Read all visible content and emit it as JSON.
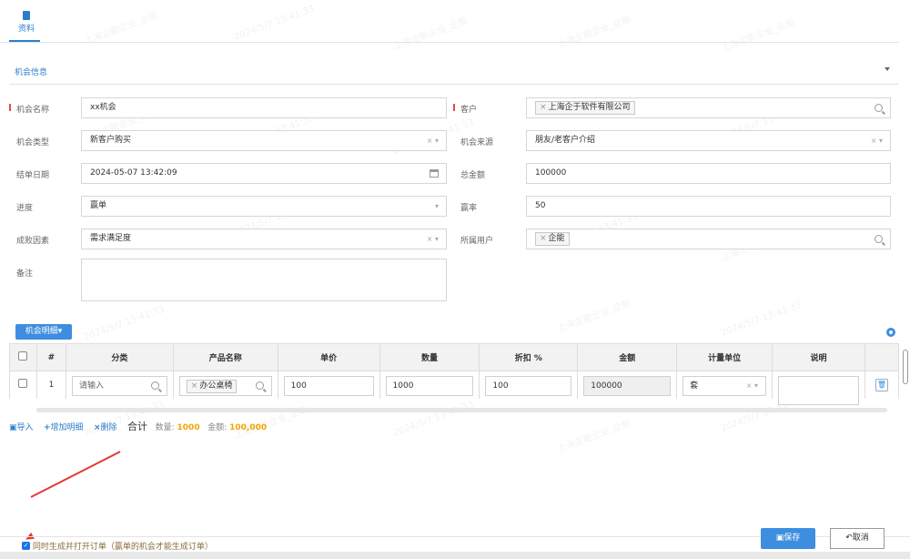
{
  "tab": {
    "label": "资料"
  },
  "section": {
    "title": "机会信息"
  },
  "form": {
    "opportunity_name_label": "机会名称",
    "opportunity_name_value": "xx机会",
    "customer_label": "客户",
    "customer_value": "上海企于软件有限公司",
    "type_label": "机会类型",
    "type_value": "新客户购买",
    "source_label": "机会来源",
    "source_value": "朋友/老客户介绍",
    "close_date_label": "结单日期",
    "close_date_value": "2024-05-07 13:42:09",
    "total_label": "总金额",
    "total_value": "100000",
    "progress_label": "进度",
    "progress_value": "赢单",
    "win_rate_label": "赢率",
    "win_rate_value": "50",
    "factor_label": "成败因素",
    "factor_value": "需求满足度",
    "owner_label": "所属用户",
    "owner_value": "企能",
    "remark_label": "备注"
  },
  "detail": {
    "tab_label": "机会明细",
    "columns": [
      "#",
      "分类",
      "产品名称",
      "单价",
      "数量",
      "折扣 %",
      "金额",
      "计量单位",
      "说明"
    ],
    "rows": [
      {
        "index": "1",
        "category_placeholder": "请输入",
        "product": "办公桌椅",
        "price": "100",
        "quantity": "1000",
        "discount": "100",
        "amount": "100000",
        "unit": "套",
        "note": ""
      }
    ]
  },
  "actions": {
    "import": "导入",
    "add_detail": "增加明细",
    "delete": "删除",
    "total_label": "合计",
    "qty_label": "数量:",
    "qty_value": "1000",
    "amount_label": "金额:",
    "amount_value": "100,000"
  },
  "bottom": {
    "checkbox_label": "同时生成并打开订单（赢单的机会才能生成订单）",
    "save": "保存",
    "cancel": "取消"
  },
  "watermark": {
    "company": "上海企能企业_企能",
    "time": "2024/5/7 13:41:33"
  },
  "colors": {
    "accent": "#2e7dcc",
    "required": "#e84b4b",
    "highlight": "#f0a500",
    "arrow": "#e53935"
  }
}
